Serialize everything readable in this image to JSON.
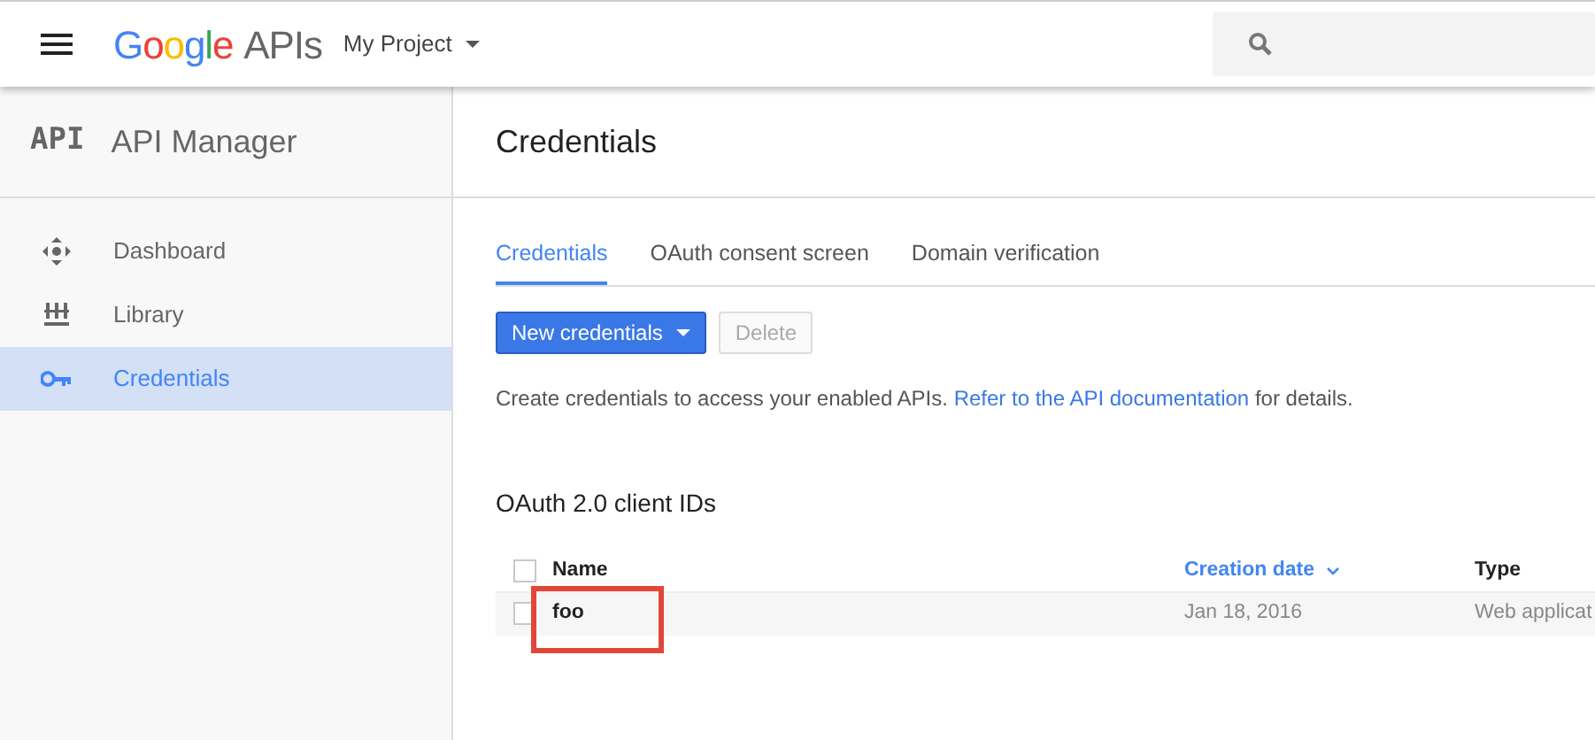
{
  "header": {
    "logo": "Google",
    "product": "APIs",
    "project": "My Project"
  },
  "sidebar": {
    "title_icon": "API",
    "title": "API Manager",
    "items": [
      {
        "label": "Dashboard",
        "kind": "dashboard",
        "selected": false
      },
      {
        "label": "Library",
        "kind": "library",
        "selected": false
      },
      {
        "label": "Credentials",
        "kind": "key",
        "selected": true
      }
    ]
  },
  "page_title": "Credentials",
  "tabs": [
    {
      "label": "Credentials",
      "selected": true
    },
    {
      "label": "OAuth consent screen",
      "selected": false
    },
    {
      "label": "Domain verification",
      "selected": false
    }
  ],
  "buttons": [
    {
      "label": "New credentials",
      "disabled": false,
      "kind": "dropdown"
    },
    {
      "label": "Delete",
      "disabled": true,
      "kind": "plain"
    }
  ],
  "info": {
    "before": "Create credentials to access your enabled APIs.",
    "link": "Refer to the API documentation",
    "after": "for details."
  },
  "section_title": "OAuth 2.0 client IDs",
  "table": {
    "select_all_checked": false,
    "columns": [
      {
        "label": "Name",
        "sorted": false
      },
      {
        "label": "Creation date",
        "sorted": true
      },
      {
        "label": "Type",
        "sorted": false
      }
    ],
    "rows": [
      {
        "name": "foo",
        "created": "Jan 18, 2016",
        "type": "Web applicat",
        "checked": false,
        "highlighted": true
      }
    ]
  }
}
